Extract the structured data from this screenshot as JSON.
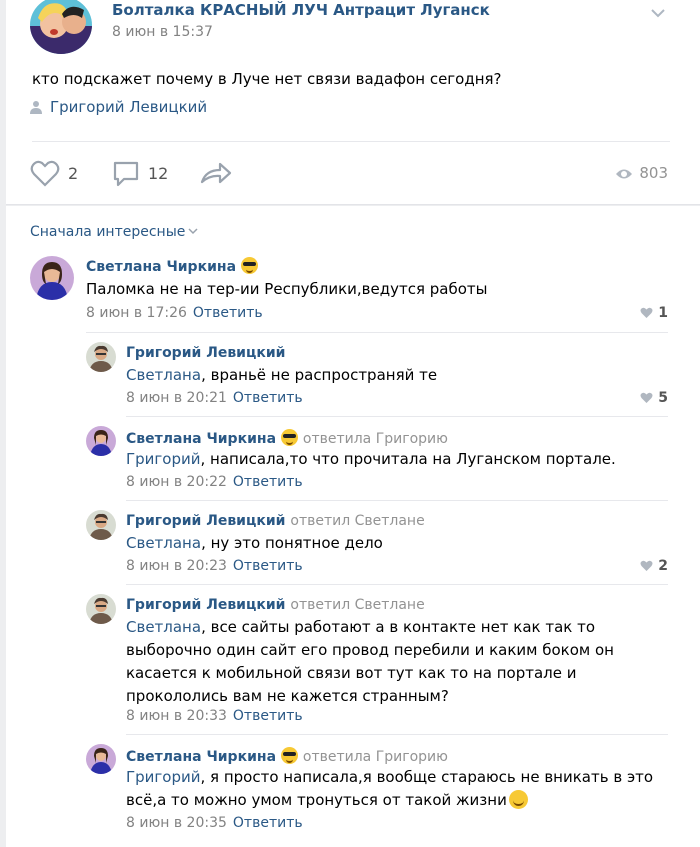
{
  "post": {
    "group_name": "Болталка КРАСНЫЙ ЛУЧ Антрацит Луганск",
    "date": "8 июн в 15:37",
    "text": "кто подскажет почему в Луче нет связи вадафон сегодня?",
    "signer": "Григорий Левицкий",
    "likes": "2",
    "comments": "12",
    "views": "803"
  },
  "sort_label": "Сначала интересные",
  "reply_label": "Ответить",
  "comments": [
    {
      "author": "Светлана Чиркина",
      "reply_to": "",
      "mention": "",
      "text": "Паломка не на тер-ии Республики,ведутся работы",
      "date": "8 июн в 17:26",
      "likes": "1"
    },
    {
      "author": "Григорий Левицкий",
      "reply_to": "",
      "mention": "Светлана",
      "text": ", враньё не распространяй те",
      "date": "8 июн в 20:21",
      "likes": "5"
    },
    {
      "author": "Светлана Чиркина",
      "reply_to": "ответила Григорию",
      "mention": "Григорий",
      "text": ", написала,то что прочитала на Луганском портале.",
      "date": "8 июн в 20:22",
      "likes": ""
    },
    {
      "author": "Григорий Левицкий",
      "reply_to": "ответил Светлане",
      "mention": "Светлана",
      "text": ", ну это понятное дело",
      "date": "8 июн в 20:23",
      "likes": "2"
    },
    {
      "author": "Григорий Левицкий",
      "reply_to": "ответил Светлане",
      "mention": "Светлана",
      "text": ", все сайты работают а в контакте нет как так то выборочно один сайт его провод перебили и каким боком он касается к мобильной связи вот тут как то на портале и прокололись вам не кажется странным?",
      "date": "8 июн в 20:33",
      "likes": ""
    },
    {
      "author": "Светлана Чиркина",
      "reply_to": "ответила Григорию",
      "mention": "Григорий",
      "text": ", я просто написала,я вообще стараюсь не вникать в это всё,а то можно умом тронуться от такой жизни",
      "date": "8 июн в 20:35",
      "likes": ""
    }
  ],
  "colors": {
    "link": "#2a5885",
    "meta": "#828282",
    "background": "#edeef0"
  },
  "icons": [
    "group-avatar",
    "chevron-down-icon",
    "user-icon",
    "heart-icon",
    "comment-icon",
    "share-icon",
    "eye-icon",
    "sunglasses-emoji",
    "smile-emoji"
  ]
}
